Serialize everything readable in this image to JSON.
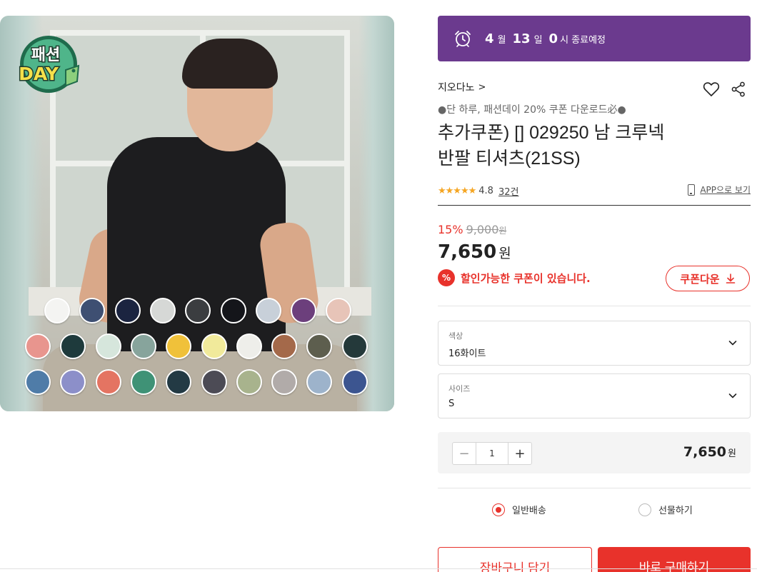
{
  "timer": {
    "month": "4",
    "month_unit": "월",
    "day": "13",
    "day_unit": "일",
    "hour": "0",
    "suffix": "시 종료예정",
    "color": "#6b3a8e"
  },
  "badge": {
    "line1": "패션",
    "line2": "DAY"
  },
  "brand": {
    "name": "지오다노",
    "chevron": ">"
  },
  "product": {
    "promo_line": "●단 하루, 패션데이 20% 쿠폰 다운로드必●",
    "title_line1": "추가쿠폰) [] 029250 남 크루넥",
    "title_line2": "반팔 티셔츠(21SS)"
  },
  "rating": {
    "stars": "★★★★★",
    "score": "4.8",
    "reviews": "32건",
    "app_link": "APP으로 보기"
  },
  "price": {
    "discount": "15%",
    "original": "9,000",
    "original_unit": "원",
    "current": "7,650",
    "current_unit": "원"
  },
  "coupon": {
    "icon_text": "%",
    "message": "할인가능한 쿠폰이 있습니다.",
    "button_label": "쿠폰다운"
  },
  "options": {
    "color": {
      "label": "색상",
      "value": "16화이트"
    },
    "size": {
      "label": "사이즈",
      "value": "S"
    }
  },
  "quantity": {
    "minus": "−",
    "value": "1",
    "plus": "+",
    "total": "7,650",
    "total_unit": "원"
  },
  "delivery": {
    "standard_label": "일반배송",
    "gift_label": "선물하기",
    "selected": "standard"
  },
  "actions": {
    "cart_label": "장바구니 담기",
    "buy_label": "바로 구매하기"
  },
  "swatches": [
    [
      "#f4f4f2",
      "#3e4f72",
      "#1b2440",
      "#d6d8d6",
      "#3b3d40",
      "#14151a",
      "#c8d0d9",
      "#6c3f7c",
      "#e7c4b8"
    ],
    [
      "#e8958e",
      "#1e3a3c",
      "#d6e6dc",
      "#87a49c",
      "#f0c13a",
      "#f1ea9b",
      "#eeeeea",
      "#a4694a",
      "#5d5e4e",
      "#24393a"
    ],
    [
      "#4f7ca8",
      "#8c8fc9",
      "#e47462",
      "#3f9276",
      "#233a44",
      "#4c4b55",
      "#a8b38d",
      "#b1aba9",
      "#9db3cb",
      "#3c5590"
    ]
  ],
  "colors": {
    "accent": "#e8322b",
    "timer_bg": "#6b3a8e",
    "star": "#f5a623"
  }
}
